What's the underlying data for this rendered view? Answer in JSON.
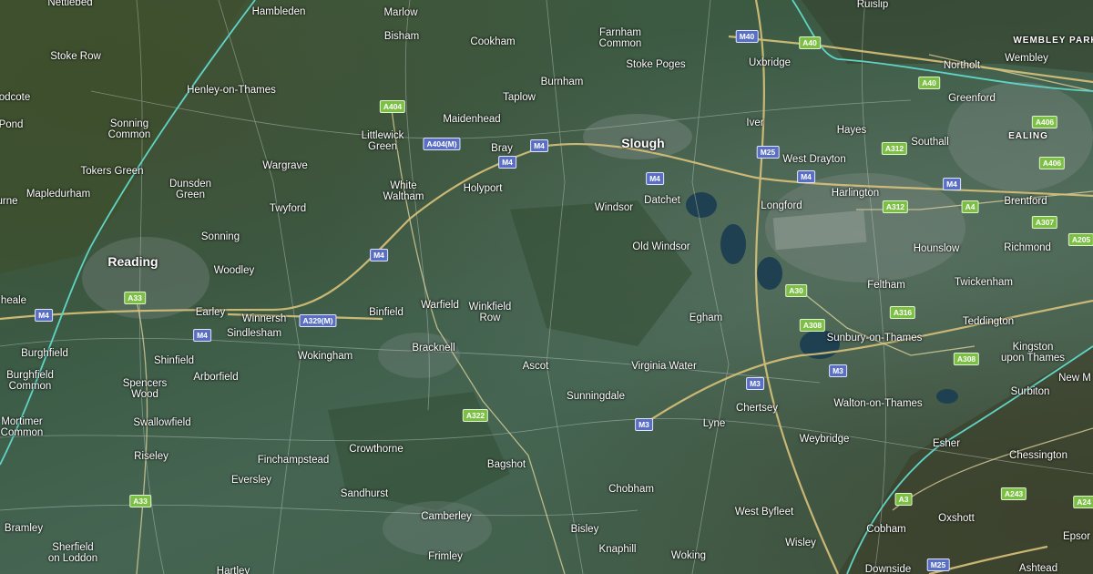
{
  "map": {
    "colors": {
      "boundary": "#5fd4c6",
      "motorway_shield": "#5a6fc4",
      "aroad_shield": "#7cbf45",
      "motorway_road": "#d9c27a"
    },
    "places": [
      {
        "name": "Nettlebed"
      },
      {
        "name": "Hambleden"
      },
      {
        "name": "Marlow"
      },
      {
        "name": "Ruislip"
      },
      {
        "name": "Stoke Row"
      },
      {
        "name": "Bisham"
      },
      {
        "name": "Cookham"
      },
      {
        "name": "Farnham\nCommon"
      },
      {
        "name": "Uxbridge"
      },
      {
        "name": "WEMBLEY PARK"
      },
      {
        "name": "Northolt"
      },
      {
        "name": "Wembley"
      },
      {
        "name": "odcote"
      },
      {
        "name": "Henley-on-Thames"
      },
      {
        "name": "Stoke Poges"
      },
      {
        "name": "Burnham"
      },
      {
        "name": "Taplow"
      },
      {
        "name": "Greenford"
      },
      {
        "name": "Pond"
      },
      {
        "name": "Sonning\nCommon"
      },
      {
        "name": "Maidenhead"
      },
      {
        "name": "Littlewick\nGreen"
      },
      {
        "name": "Bray"
      },
      {
        "name": "Slough"
      },
      {
        "name": "Iver"
      },
      {
        "name": "Hayes"
      },
      {
        "name": "Southall"
      },
      {
        "name": "EALING"
      },
      {
        "name": "Tokers Green"
      },
      {
        "name": "Wargrave"
      },
      {
        "name": "West Drayton"
      },
      {
        "name": "Dunsden\nGreen"
      },
      {
        "name": "White\nWaltham"
      },
      {
        "name": "Holyport"
      },
      {
        "name": "Datchet"
      },
      {
        "name": "Harlington"
      },
      {
        "name": "Brentford"
      },
      {
        "name": "urne"
      },
      {
        "name": "Mapledurham"
      },
      {
        "name": "Windsor"
      },
      {
        "name": "Longford"
      },
      {
        "name": "Twyford"
      },
      {
        "name": "Sonning"
      },
      {
        "name": "Old Windsor"
      },
      {
        "name": "Hounslow"
      },
      {
        "name": "Richmond"
      },
      {
        "name": "Reading"
      },
      {
        "name": "Woodley"
      },
      {
        "name": "Feltham"
      },
      {
        "name": "Twickenham"
      },
      {
        "name": "heale"
      },
      {
        "name": "Earley"
      },
      {
        "name": "Warfield"
      },
      {
        "name": "Winkfield\nRow"
      },
      {
        "name": "Binfield"
      },
      {
        "name": "Winnersh"
      },
      {
        "name": "Egham"
      },
      {
        "name": "Teddington"
      },
      {
        "name": "Sindlesham"
      },
      {
        "name": "Sunbury-on-Thames"
      },
      {
        "name": "Kingston\nupon Thames"
      },
      {
        "name": "Burghfield"
      },
      {
        "name": "Shinfield"
      },
      {
        "name": "Bracknell"
      },
      {
        "name": "Wokingham"
      },
      {
        "name": "Ascot"
      },
      {
        "name": "Virginia Water"
      },
      {
        "name": "New M"
      },
      {
        "name": "Burghfield\nCommon"
      },
      {
        "name": "Arborfield"
      },
      {
        "name": "Spencers\nWood"
      },
      {
        "name": "Sunningdale"
      },
      {
        "name": "Walton-on-Thames"
      },
      {
        "name": "Surbiton"
      },
      {
        "name": "Chertsey"
      },
      {
        "name": "Mortimer\nCommon"
      },
      {
        "name": "Swallowfield"
      },
      {
        "name": "Lyne"
      },
      {
        "name": "Weybridge"
      },
      {
        "name": "Esher"
      },
      {
        "name": "Crowthorne"
      },
      {
        "name": "Chessington"
      },
      {
        "name": "Riseley"
      },
      {
        "name": "Finchampstead"
      },
      {
        "name": "Bagshot"
      },
      {
        "name": "Eversley"
      },
      {
        "name": "Chobham"
      },
      {
        "name": "Sandhurst"
      },
      {
        "name": "West Byfleet"
      },
      {
        "name": "Oxshott"
      },
      {
        "name": "Camberley"
      },
      {
        "name": "Bramley"
      },
      {
        "name": "Bisley"
      },
      {
        "name": "Cobham"
      },
      {
        "name": "Epsor"
      },
      {
        "name": "Sherfield\non Loddon"
      },
      {
        "name": "Wisley"
      },
      {
        "name": "Knaphill"
      },
      {
        "name": "Woking"
      },
      {
        "name": "Frimley"
      },
      {
        "name": "Hartley"
      },
      {
        "name": "Downside"
      },
      {
        "name": "Ashtead"
      }
    ],
    "shields": [
      {
        "label": "M40",
        "type": "m"
      },
      {
        "label": "A40",
        "type": "a"
      },
      {
        "label": "A40",
        "type": "a"
      },
      {
        "label": "A404",
        "type": "a"
      },
      {
        "label": "A404(M)",
        "type": "m"
      },
      {
        "label": "M4",
        "type": "m"
      },
      {
        "label": "M4",
        "type": "m"
      },
      {
        "label": "M25",
        "type": "m"
      },
      {
        "label": "A312",
        "type": "a"
      },
      {
        "label": "A406",
        "type": "a"
      },
      {
        "label": "A406",
        "type": "a"
      },
      {
        "label": "M4",
        "type": "m"
      },
      {
        "label": "M4",
        "type": "m"
      },
      {
        "label": "M4",
        "type": "m"
      },
      {
        "label": "A312",
        "type": "a"
      },
      {
        "label": "A4",
        "type": "a"
      },
      {
        "label": "A307",
        "type": "a"
      },
      {
        "label": "A205",
        "type": "a"
      },
      {
        "label": "M4",
        "type": "m"
      },
      {
        "label": "A33",
        "type": "a"
      },
      {
        "label": "M4",
        "type": "m"
      },
      {
        "label": "A329(M)",
        "type": "m"
      },
      {
        "label": "M4",
        "type": "m"
      },
      {
        "label": "A30",
        "type": "a"
      },
      {
        "label": "A316",
        "type": "a"
      },
      {
        "label": "A308",
        "type": "a"
      },
      {
        "label": "A308",
        "type": "a"
      },
      {
        "label": "M3",
        "type": "m"
      },
      {
        "label": "M3",
        "type": "m"
      },
      {
        "label": "A322",
        "type": "a"
      },
      {
        "label": "M3",
        "type": "m"
      },
      {
        "label": "A33",
        "type": "a"
      },
      {
        "label": "A3",
        "type": "a"
      },
      {
        "label": "A243",
        "type": "a"
      },
      {
        "label": "A24",
        "type": "a"
      },
      {
        "label": "M25",
        "type": "m"
      }
    ]
  }
}
